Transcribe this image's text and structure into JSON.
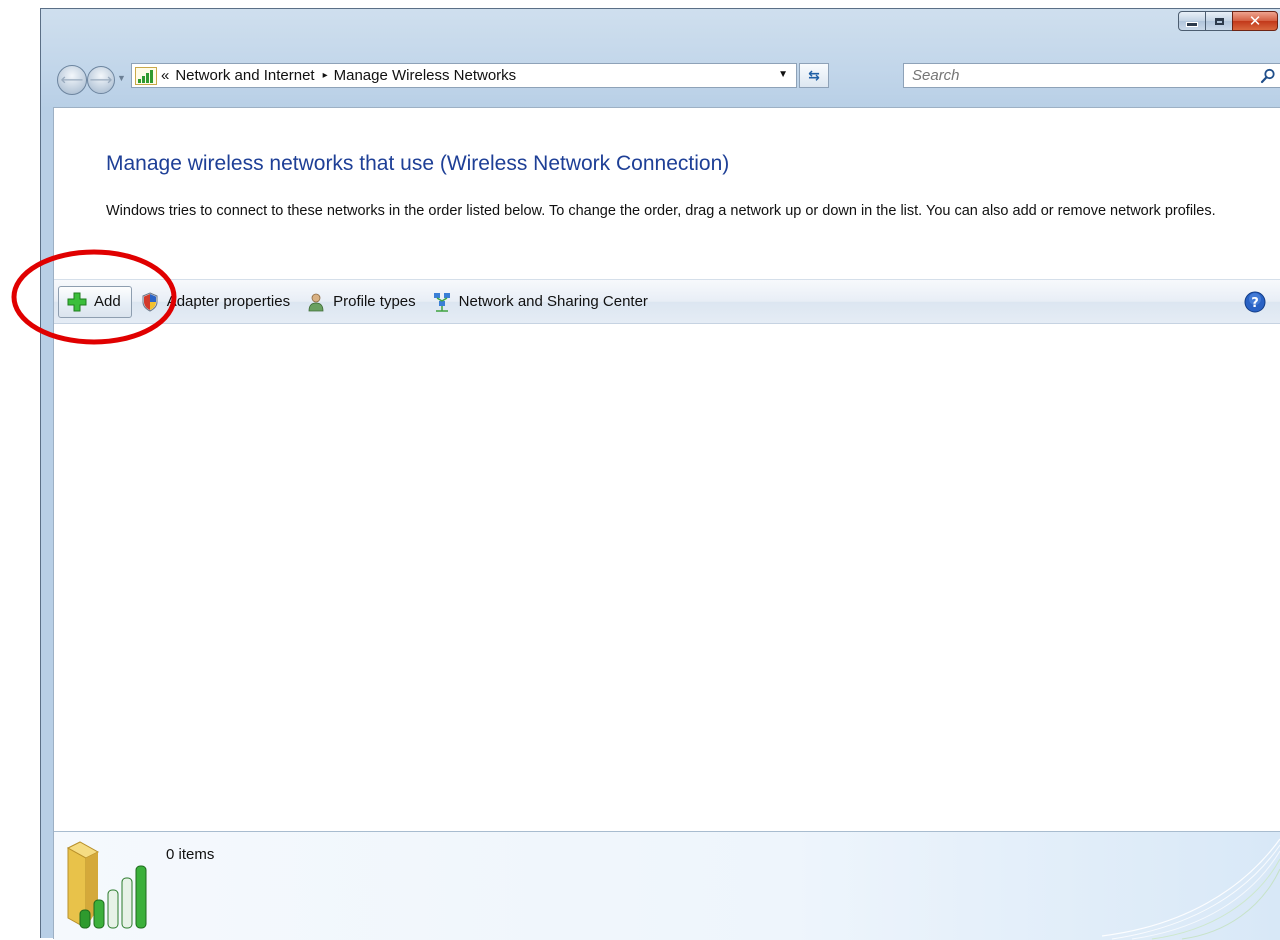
{
  "window": {
    "colors": {
      "title_accent": "#1e3f96",
      "close_button": "#c2381a"
    },
    "caption_buttons": [
      "minimize",
      "maximize",
      "close"
    ]
  },
  "nav": {
    "address": {
      "overflow": "«",
      "segments": [
        "Network and Internet",
        "Manage Wireless Networks"
      ],
      "separator": "▸"
    },
    "search": {
      "placeholder": "Search"
    }
  },
  "content": {
    "title": "Manage wireless networks that use (Wireless Network Connection)",
    "description": "Windows tries to connect to these networks in the order listed below. To change the order, drag a network up or down in the list. You can also add or remove network profiles."
  },
  "toolbar": {
    "items": [
      {
        "label": "Add",
        "icon": "green-plus-icon"
      },
      {
        "label": "Adapter properties",
        "icon": "shield-icon"
      },
      {
        "label": "Profile types",
        "icon": "user-icon"
      },
      {
        "label": "Network and Sharing Center",
        "icon": "network-icon"
      }
    ],
    "help_icon": "help-icon"
  },
  "details": {
    "count": "0 items"
  },
  "annotation": {
    "color": "#e00000",
    "target": "Add"
  }
}
